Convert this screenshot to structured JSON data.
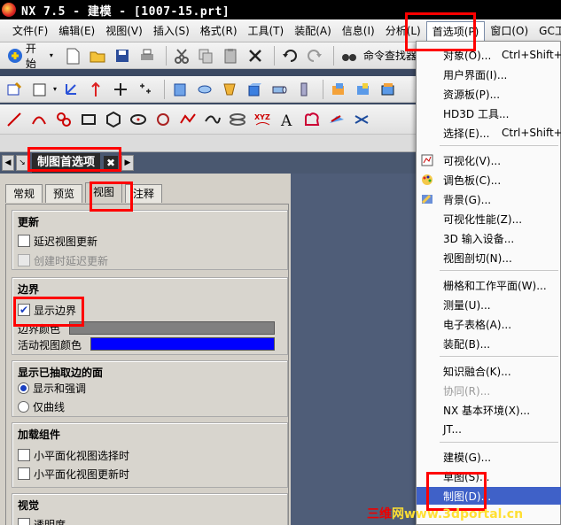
{
  "titlebar": {
    "title": "NX 7.5 - 建模 - [1007-15.prt]"
  },
  "menubar": {
    "items": [
      "文件(F)",
      "编辑(E)",
      "视图(V)",
      "插入(S)",
      "格式(R)",
      "工具(T)",
      "装配(A)",
      "信息(I)",
      "分析(L)",
      "首选项(P)",
      "窗口(O)",
      "GC工具箱"
    ]
  },
  "toolbar": {
    "start_label": "开始",
    "command_finder_label": "命令查找器"
  },
  "nav": {
    "title": "制图首选项"
  },
  "tabs": [
    "常规",
    "预览",
    "视图",
    "注释"
  ],
  "groups": {
    "update": {
      "title": "更新",
      "delay_view_update": "延迟视图更新",
      "delay_on_create": "创建时延迟更新"
    },
    "border": {
      "title": "边界",
      "show_border": "显示边界",
      "border_color_label": "边界颜色",
      "active_view_color_label": "活动视图颜色",
      "border_color": "#808080",
      "active_view_color": "#0000ff"
    },
    "extracted": {
      "title": "显示已抽取边的面",
      "show_and_highlight": "显示和强调",
      "curves_only": "仅曲线"
    },
    "loaded": {
      "title": "加载组件",
      "on_facet_select": "小平面化视图选择时",
      "on_facet_update": "小平面化视图更新时"
    },
    "visual": {
      "title": "视觉",
      "transparency": "透明度"
    }
  },
  "dropdown": {
    "items": [
      {
        "label": "对象(O)...",
        "key": "Ctrl+Shift+J",
        "icon": ""
      },
      {
        "label": "用户界面(I)...",
        "key": "",
        "icon": ""
      },
      {
        "label": "资源板(P)...",
        "key": "",
        "icon": ""
      },
      {
        "label": "HD3D 工具...",
        "key": "",
        "icon": ""
      },
      {
        "label": "选择(E)...",
        "key": "Ctrl+Shift+T",
        "icon": ""
      },
      {
        "label": "可视化(V)...",
        "key": "",
        "icon": "visualization-icon"
      },
      {
        "label": "调色板(C)...",
        "key": "",
        "icon": "palette-icon"
      },
      {
        "label": "背景(G)...",
        "key": "",
        "icon": "background-icon"
      },
      {
        "label": "可视化性能(Z)...",
        "key": "",
        "icon": ""
      },
      {
        "label": "3D 输入设备...",
        "key": "",
        "icon": ""
      },
      {
        "label": "视图剖切(N)...",
        "key": "",
        "icon": ""
      },
      {
        "label": "栅格和工作平面(W)...",
        "key": "",
        "icon": ""
      },
      {
        "label": "测量(U)...",
        "key": "",
        "icon": ""
      },
      {
        "label": "电子表格(A)...",
        "key": "",
        "icon": ""
      },
      {
        "label": "装配(B)...",
        "key": "",
        "icon": ""
      },
      {
        "label": "知识融合(K)...",
        "key": "",
        "icon": ""
      },
      {
        "label": "协同(R)...",
        "key": "",
        "icon": ""
      },
      {
        "label": "NX 基本环境(X)...",
        "key": "",
        "icon": ""
      },
      {
        "label": "JT...",
        "key": "",
        "icon": ""
      },
      {
        "label": "建模(G)...",
        "key": "",
        "icon": ""
      },
      {
        "label": "草图(S)...",
        "key": "",
        "icon": ""
      },
      {
        "label": "制图(D)...",
        "key": "",
        "icon": ""
      }
    ]
  },
  "watermark": {
    "left": "三维",
    "right": "网www.3dportal.cn"
  }
}
